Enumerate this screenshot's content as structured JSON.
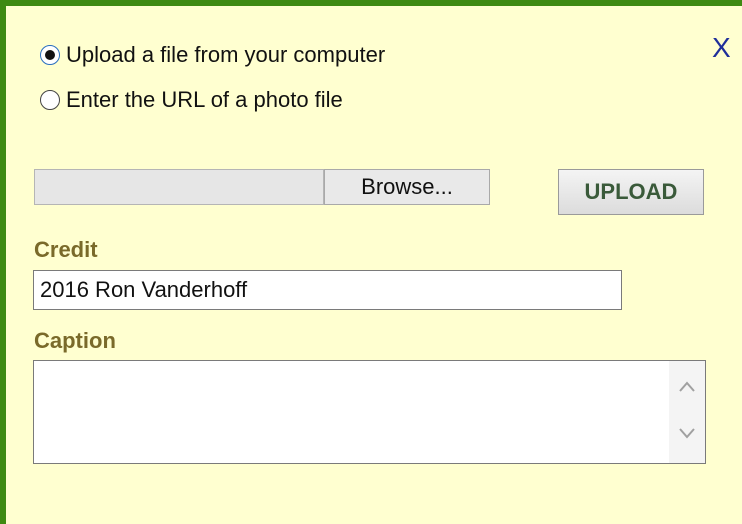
{
  "dialog": {
    "close_label": "X",
    "source_options": [
      {
        "label": "Upload a file from your computer",
        "checked": true
      },
      {
        "label": "Enter the URL of a photo file",
        "checked": false
      }
    ],
    "browse_label": "Browse...",
    "upload_label": "UPLOAD",
    "credit": {
      "label": "Credit",
      "value": "2016 Ron Vanderhoff"
    },
    "caption": {
      "label": "Caption",
      "value": ""
    }
  },
  "colors": {
    "background": "#ffffd0",
    "border": "#3e8a12",
    "label": "#7a6a2a",
    "close": "#1f2f9a"
  }
}
